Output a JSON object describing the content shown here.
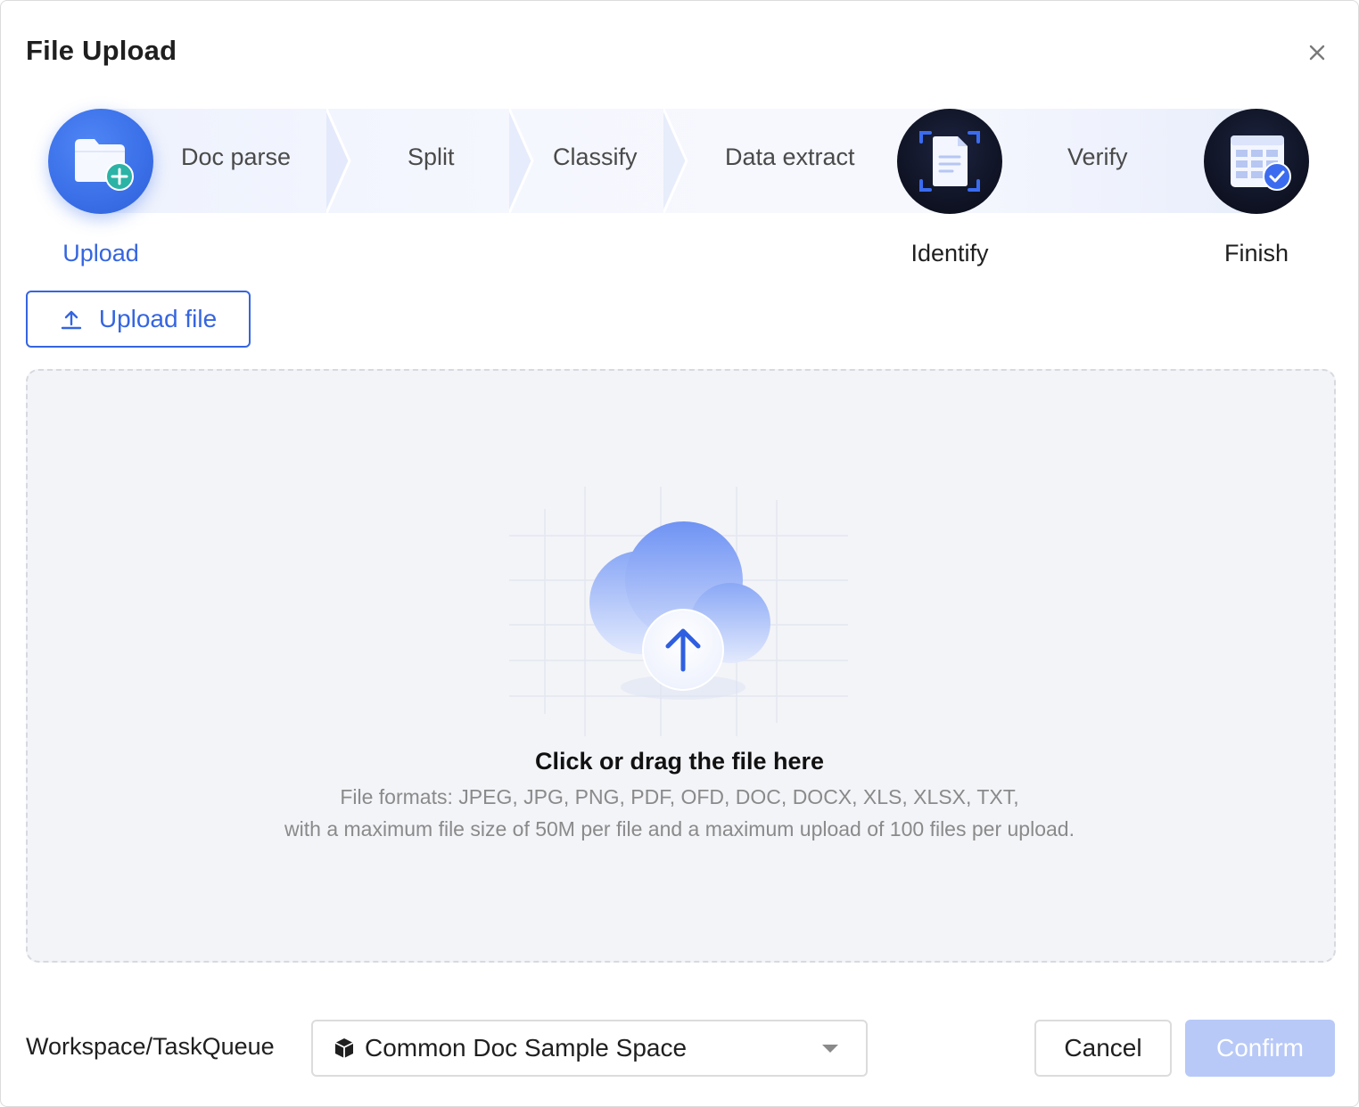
{
  "dialog": {
    "title": "File Upload",
    "close_icon": "close-icon"
  },
  "steps": {
    "upload": {
      "label": "Upload",
      "icon": "folder-add-icon",
      "active": true
    },
    "intermediate": [
      "Doc parse",
      "Split",
      "Classify",
      "Data extract"
    ],
    "identify": {
      "label": "Identify",
      "icon": "document-scan-icon"
    },
    "verify": "Verify",
    "finish": {
      "label": "Finish",
      "icon": "table-check-icon"
    }
  },
  "upload_button": {
    "label": "Upload file",
    "icon": "upload-icon"
  },
  "dropzone": {
    "icon": "cloud-upload-icon",
    "title": "Click or drag the file here",
    "formats": "File formats: JPEG, JPG, PNG, PDF, OFD, DOC, DOCX, XLS, XLSX, TXT,",
    "limits": "with a maximum file size of 50M per file and a maximum upload of 100 files per upload."
  },
  "footer": {
    "workspace_label": "Workspace/TaskQueue",
    "workspace_value": "Common Doc Sample Space",
    "workspace_icon": "cube-icon",
    "dropdown_icon": "caret-down-icon",
    "cancel_label": "Cancel",
    "confirm_label": "Confirm"
  },
  "colors": {
    "accent": "#3565e0",
    "confirm_disabled": "#b8c9f7",
    "dark_step": "#0e1222",
    "dropzone_bg": "#f3f4f8"
  }
}
